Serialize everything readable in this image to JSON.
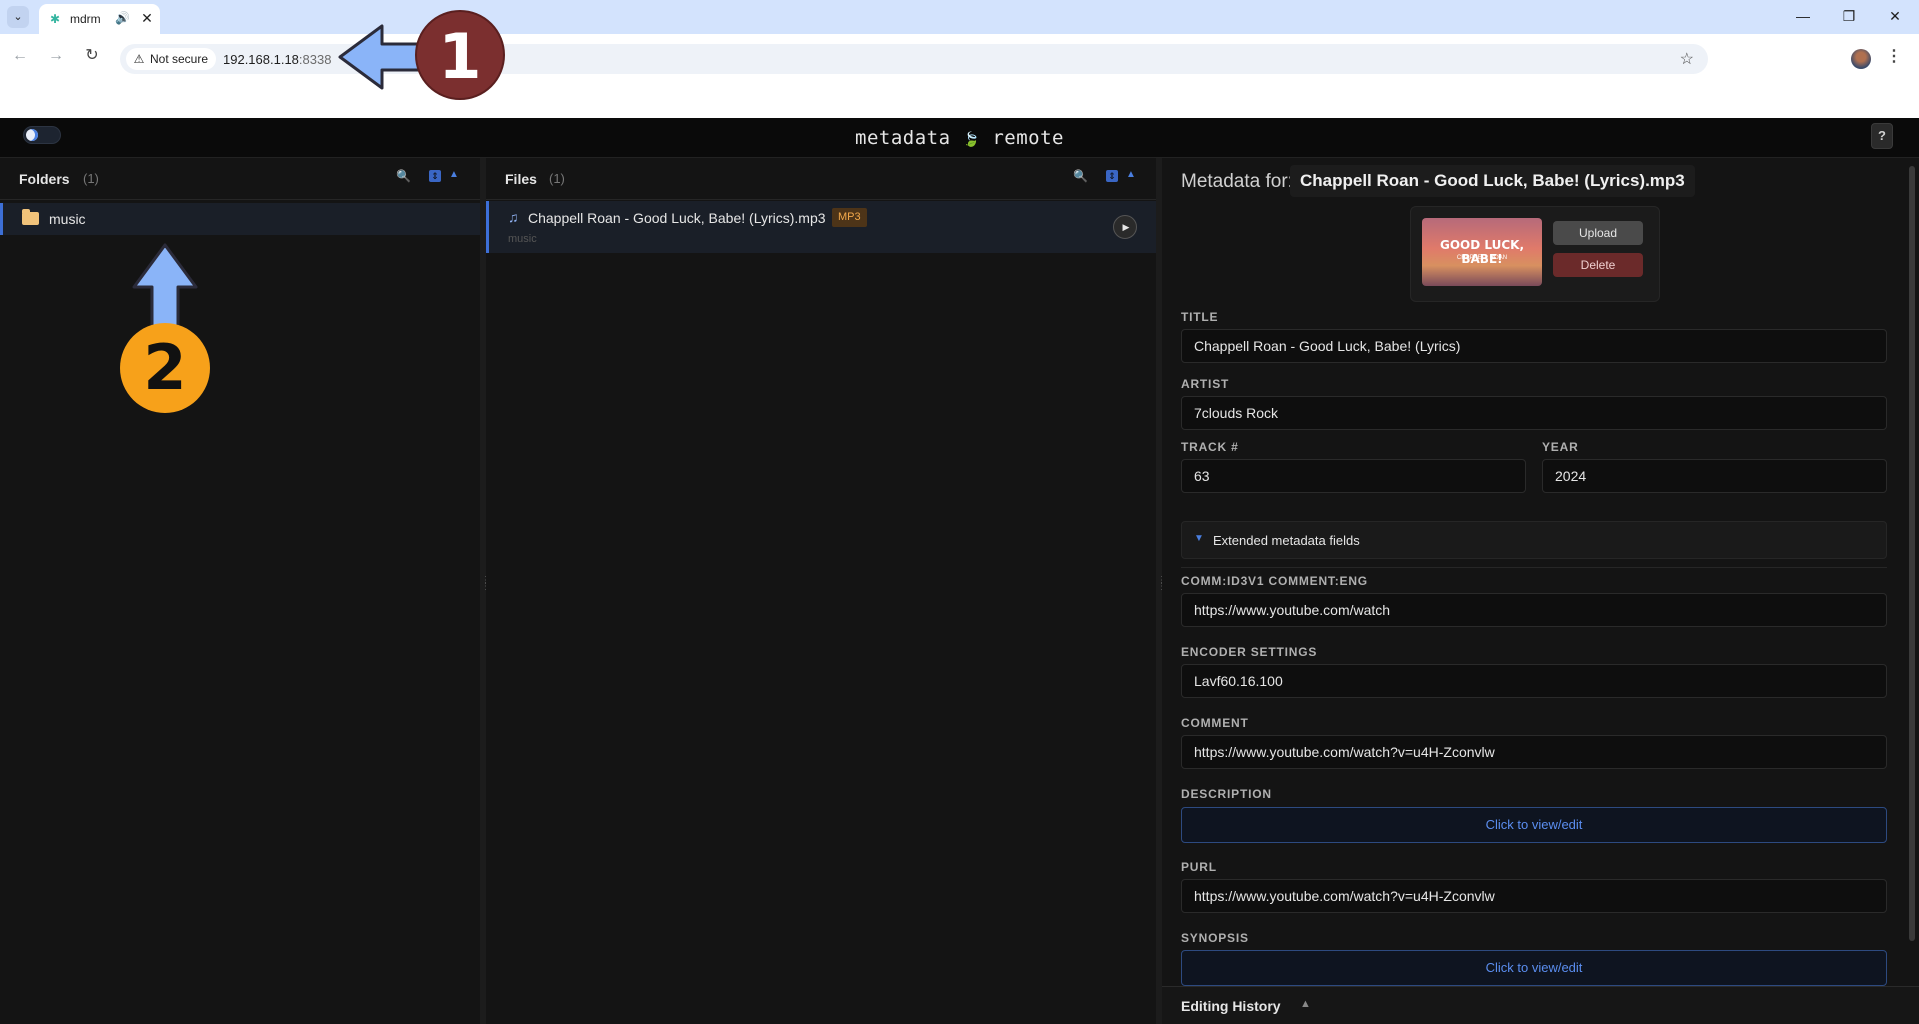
{
  "browser": {
    "tab_title": "mdrm",
    "tab_close": "✕",
    "tab_audio": "🔊",
    "security_label": "Not secure",
    "url_host": "192.168.1.18",
    "url_port": ":8338",
    "back_glyph": "←",
    "forward_glyph": "→",
    "reload_glyph": "↻",
    "star_glyph": "☆",
    "menu_glyph": "⋮",
    "win_minimize": "—",
    "win_restore": "❐",
    "win_close": "✕"
  },
  "app": {
    "title_left": "metadata",
    "title_icon": "🍃",
    "title_right": "remote",
    "help_label": "?"
  },
  "folders": {
    "label": "Folders",
    "count": "(1)",
    "items": [
      {
        "label": "music"
      }
    ]
  },
  "files": {
    "label": "Files",
    "count": "(1)",
    "items": [
      {
        "name": "Chappell Roan - Good Luck, Babe! (Lyrics).mp3",
        "badge": "MP3",
        "folder": "music"
      }
    ]
  },
  "metadata": {
    "heading": "Metadata for:",
    "filename": "Chappell Roan - Good Luck, Babe! (Lyrics).mp3",
    "art": {
      "main_text": "GOOD LUCK, BABE!",
      "sub_text": "CHAPPELL ROAN"
    },
    "upload_label": "Upload",
    "delete_label": "Delete",
    "title_label": "TITLE",
    "title_value": "Chappell Roan - Good Luck, Babe! (Lyrics)",
    "artist_label": "ARTIST",
    "artist_value": "7clouds Rock",
    "track_label": "TRACK #",
    "track_value": "63",
    "year_label": "YEAR",
    "year_value": "2024",
    "extended_label": "Extended metadata fields",
    "extended_caret": "▼",
    "ext_fields": [
      {
        "label": "COMM:ID3V1 COMMENT:ENG",
        "value": "https://www.youtube.com/watch"
      },
      {
        "label": "ENCODER SETTINGS",
        "value": "Lavf60.16.100"
      },
      {
        "label": "COMMENT",
        "value": "https://www.youtube.com/watch?v=u4H-Zconvlw"
      },
      {
        "label": "DESCRIPTION",
        "link": "Click to view/edit"
      },
      {
        "label": "PURL",
        "value": "https://www.youtube.com/watch?v=u4H-Zconvlw"
      },
      {
        "label": "SYNOPSIS",
        "link": "Click to view/edit"
      }
    ],
    "history_label": "Editing History",
    "history_caret": "▲"
  },
  "annotations": {
    "callout_1": "1",
    "callout_2": "2"
  },
  "colors": {
    "accent": "#3d6fd6",
    "callout_1": "#7b2f2f",
    "callout_2": "#f7a11a",
    "arrow": "#8ab4f8"
  }
}
